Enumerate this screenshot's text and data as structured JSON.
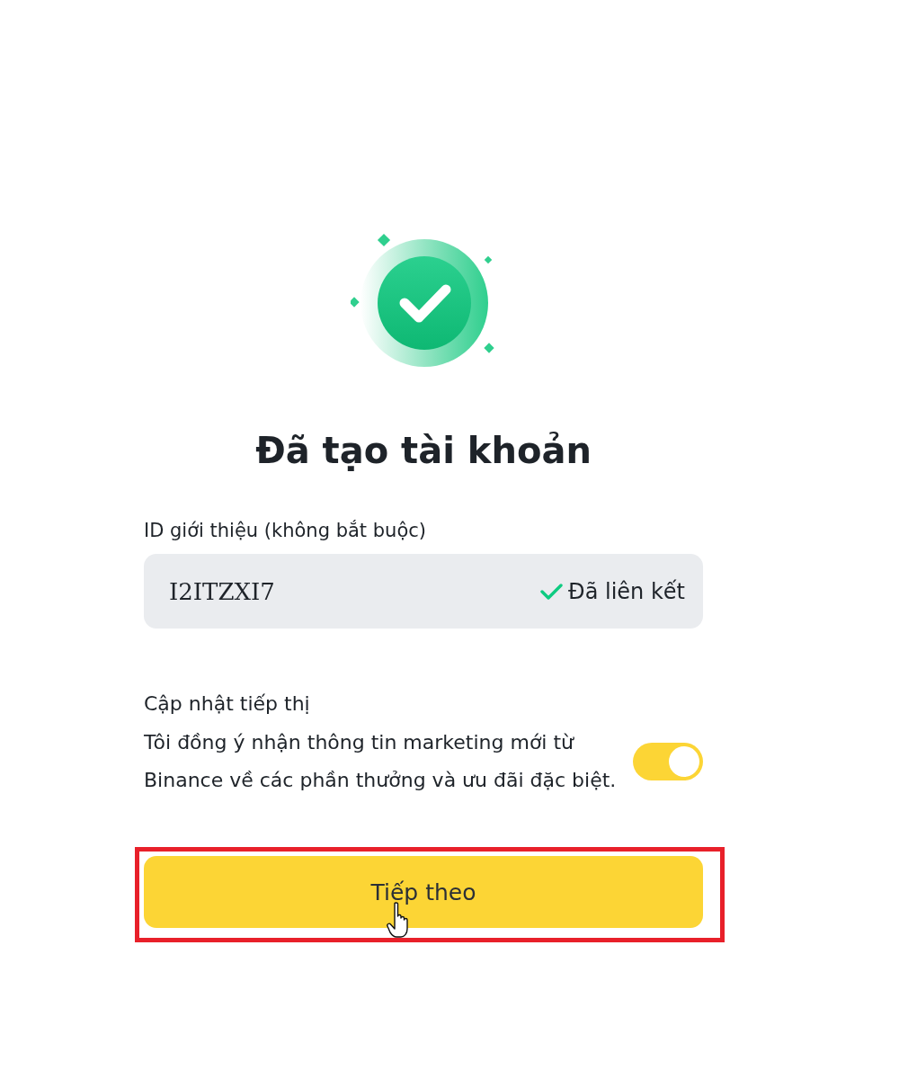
{
  "heading": "Đã tạo tài khoản",
  "referral": {
    "label": "ID giới thiệu (không bắt buộc)",
    "value": "I2ITZXI7",
    "status": "Đã liên kết"
  },
  "marketing": {
    "title": "Cập nhật tiếp thị",
    "description": "Tôi đồng ý nhận thông tin marketing mới từ Binance về các phần thưởng và ưu đãi đặc biệt.",
    "on": true
  },
  "next_button": {
    "label": "Tiếp theo",
    "highlighted": true
  }
}
